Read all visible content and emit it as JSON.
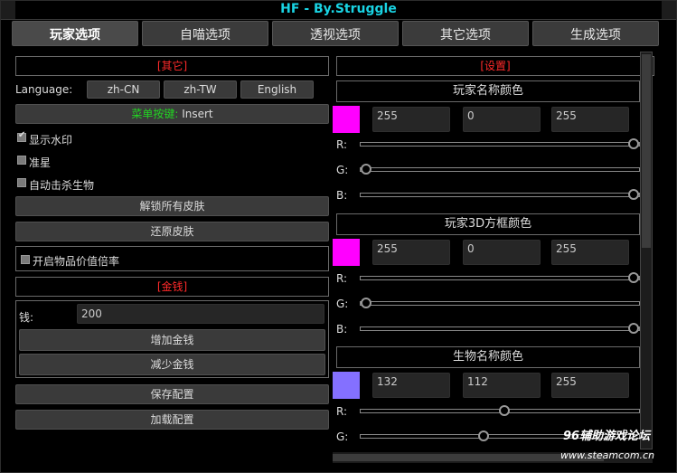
{
  "window": {
    "title": "HF - By.Struggle"
  },
  "tabs": [
    "玩家选项",
    "自喵选项",
    "透视选项",
    "其它选项",
    "生成选项"
  ],
  "left": {
    "other_header": "[其它]",
    "language_label": "Language:",
    "languages": [
      "zh-CN",
      "zh-TW",
      "English"
    ],
    "menu_key_label": "菜单按键:",
    "menu_key_value": "Insert",
    "checkboxes": [
      {
        "label": "显示水印",
        "checked": true
      },
      {
        "label": "准星",
        "checked": false
      },
      {
        "label": "自动击杀生物",
        "checked": false
      }
    ],
    "unlock_skins": "解锁所有皮肤",
    "restore_skins": "还原皮肤",
    "item_value_multiplier": "开启物品价值倍率",
    "money_header": "[金钱]",
    "money_label": "钱:",
    "money_value": "200",
    "add_money": "增加金钱",
    "reduce_money": "减少金钱",
    "save_config": "保存配置",
    "load_config": "加载配置"
  },
  "right": {
    "settings_header": "[设置]",
    "colors": [
      {
        "title": "玩家名称颜色",
        "hex": "#ff00ff",
        "r": "255",
        "g": "0",
        "b": "255",
        "r_frac": 1.0,
        "g_frac": 0.0,
        "b_frac": 1.0
      },
      {
        "title": "玩家3D方框颜色",
        "hex": "#ff00ff",
        "r": "255",
        "g": "0",
        "b": "255",
        "r_frac": 1.0,
        "g_frac": 0.0,
        "b_frac": 1.0
      },
      {
        "title": "生物名称颜色",
        "hex": "#8470ff",
        "r": "132",
        "g": "112",
        "b": "255",
        "r_frac": 0.518,
        "g_frac": 0.439,
        "b_frac": 1.0
      }
    ],
    "slider_labels": [
      "R:",
      "G:",
      "B:"
    ]
  },
  "watermark": {
    "line1": "96辅助游戏论坛",
    "line2": "www.steamcom.cn"
  }
}
